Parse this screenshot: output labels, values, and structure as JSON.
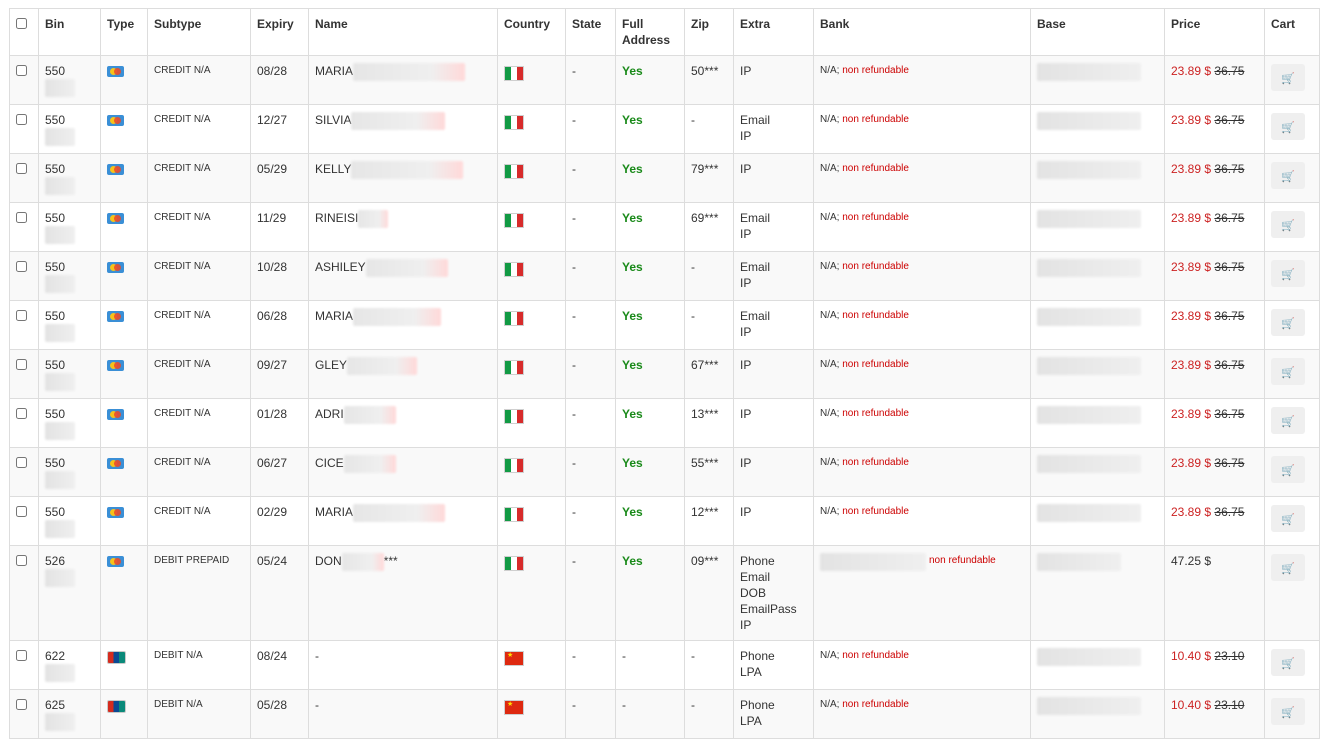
{
  "headers": {
    "bin": "Bin",
    "type": "Type",
    "subtype": "Subtype",
    "expiry": "Expiry",
    "name": "Name",
    "country": "Country",
    "state": "State",
    "full_address": "Full Address",
    "zip": "Zip",
    "extra": "Extra",
    "bank": "Bank",
    "base": "Base",
    "price": "Price",
    "cart": "Cart"
  },
  "rows": [
    {
      "bin": "550",
      "card_icon": "mastercard-icon",
      "subtype": "CREDIT N/A",
      "expiry": "08/28",
      "name": "MARIA",
      "country_flag": "italy-flag-icon",
      "state": "-",
      "full_address": "Yes",
      "zip": "50***",
      "extra": [
        "IP"
      ],
      "bank": "N/A;",
      "bank_note": "non refundable",
      "price": "23.89 $",
      "old_price": "36.75"
    },
    {
      "bin": "550",
      "card_icon": "mastercard-icon",
      "subtype": "CREDIT N/A",
      "expiry": "12/27",
      "name": "SILVIA",
      "country_flag": "italy-flag-icon",
      "state": "-",
      "full_address": "Yes",
      "zip": "-",
      "extra": [
        "Email",
        "IP"
      ],
      "bank": "N/A;",
      "bank_note": "non refundable",
      "price": "23.89 $",
      "old_price": "36.75"
    },
    {
      "bin": "550",
      "card_icon": "mastercard-icon",
      "subtype": "CREDIT N/A",
      "expiry": "05/29",
      "name": "KELLY",
      "country_flag": "italy-flag-icon",
      "state": "-",
      "full_address": "Yes",
      "zip": "79***",
      "extra": [
        "IP"
      ],
      "bank": "N/A;",
      "bank_note": "non refundable",
      "price": "23.89 $",
      "old_price": "36.75"
    },
    {
      "bin": "550",
      "card_icon": "mastercard-icon",
      "subtype": "CREDIT N/A",
      "expiry": "11/29",
      "name": "RINEISI",
      "country_flag": "italy-flag-icon",
      "state": "-",
      "full_address": "Yes",
      "zip": "69***",
      "extra": [
        "Email",
        "IP"
      ],
      "bank": "N/A;",
      "bank_note": "non refundable",
      "price": "23.89 $",
      "old_price": "36.75"
    },
    {
      "bin": "550",
      "card_icon": "mastercard-icon",
      "subtype": "CREDIT N/A",
      "expiry": "10/28",
      "name": "ASHILEY",
      "country_flag": "italy-flag-icon",
      "state": "-",
      "full_address": "Yes",
      "zip": "-",
      "extra": [
        "Email",
        "IP"
      ],
      "bank": "N/A;",
      "bank_note": "non refundable",
      "price": "23.89 $",
      "old_price": "36.75"
    },
    {
      "bin": "550",
      "card_icon": "mastercard-icon",
      "subtype": "CREDIT N/A",
      "expiry": "06/28",
      "name": "MARIA",
      "country_flag": "italy-flag-icon",
      "state": "-",
      "full_address": "Yes",
      "zip": "-",
      "extra": [
        "Email",
        "IP"
      ],
      "bank": "N/A;",
      "bank_note": "non refundable",
      "price": "23.89 $",
      "old_price": "36.75"
    },
    {
      "bin": "550",
      "card_icon": "mastercard-icon",
      "subtype": "CREDIT N/A",
      "expiry": "09/27",
      "name": "GLEY",
      "country_flag": "italy-flag-icon",
      "state": "-",
      "full_address": "Yes",
      "zip": "67***",
      "extra": [
        "IP"
      ],
      "bank": "N/A;",
      "bank_note": "non refundable",
      "price": "23.89 $",
      "old_price": "36.75"
    },
    {
      "bin": "550",
      "card_icon": "mastercard-icon",
      "subtype": "CREDIT N/A",
      "expiry": "01/28",
      "name": "ADRI",
      "country_flag": "italy-flag-icon",
      "state": "-",
      "full_address": "Yes",
      "zip": "13***",
      "extra": [
        "IP"
      ],
      "bank": "N/A;",
      "bank_note": "non refundable",
      "price": "23.89 $",
      "old_price": "36.75"
    },
    {
      "bin": "550",
      "card_icon": "mastercard-icon",
      "subtype": "CREDIT N/A",
      "expiry": "06/27",
      "name": "CICE",
      "country_flag": "italy-flag-icon",
      "state": "-",
      "full_address": "Yes",
      "zip": "55***",
      "extra": [
        "IP"
      ],
      "bank": "N/A;",
      "bank_note": "non refundable",
      "price": "23.89 $",
      "old_price": "36.75"
    },
    {
      "bin": "550",
      "card_icon": "mastercard-icon",
      "subtype": "CREDIT N/A",
      "expiry": "02/29",
      "name": "MARIA",
      "country_flag": "italy-flag-icon",
      "state": "-",
      "full_address": "Yes",
      "zip": "12***",
      "extra": [
        "IP"
      ],
      "bank": "N/A;",
      "bank_note": "non refundable",
      "price": "23.89 $",
      "old_price": "36.75"
    },
    {
      "bin": "526",
      "card_icon": "mastercard-icon",
      "subtype": "DEBIT PREPAID",
      "expiry": "05/24",
      "name": "DON",
      "name_suffix": "***",
      "country_flag": "italy-flag-icon",
      "state": "-",
      "full_address": "Yes",
      "zip": "09***",
      "extra": [
        "Phone",
        "Email",
        "DOB",
        "EmailPass",
        "IP"
      ],
      "bank": "",
      "bank_note": "non refundable",
      "price": "47.25 $",
      "old_price": ""
    },
    {
      "bin": "622",
      "card_icon": "unionpay-icon",
      "subtype": "DEBIT N/A",
      "expiry": "08/24",
      "name": "-",
      "country_flag": "china-flag-icon",
      "state": "-",
      "full_address": "-",
      "zip": "-",
      "extra": [
        "Phone",
        "LPA"
      ],
      "bank": "N/A;",
      "bank_note": "non refundable",
      "price": "10.40 $",
      "old_price": "23.10"
    },
    {
      "bin": "625",
      "card_icon": "unionpay-icon",
      "subtype": "DEBIT N/A",
      "expiry": "05/28",
      "name": "-",
      "country_flag": "china-flag-icon",
      "state": "-",
      "full_address": "-",
      "zip": "-",
      "extra": [
        "Phone",
        "LPA"
      ],
      "bank": "N/A;",
      "bank_note": "non refundable",
      "price": "10.40 $",
      "old_price": "23.10"
    }
  ]
}
